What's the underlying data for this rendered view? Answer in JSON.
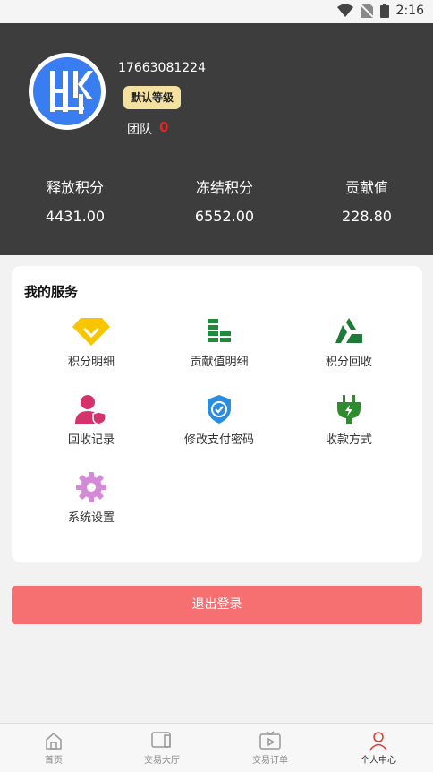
{
  "status_bar": {
    "time": "2:16"
  },
  "profile": {
    "phone": "17663081224",
    "level_badge": "默认等级",
    "team_label": "团队",
    "team_count": "0"
  },
  "stats": [
    {
      "label": "释放积分",
      "value": "4431.00"
    },
    {
      "label": "冻结积分",
      "value": "6552.00"
    },
    {
      "label": "贡献值",
      "value": "228.80"
    }
  ],
  "services": {
    "title": "我的服务",
    "items": [
      {
        "label": "积分明细",
        "icon": "diamond-icon"
      },
      {
        "label": "贡献值明细",
        "icon": "coin-stack-icon"
      },
      {
        "label": "积分回收",
        "icon": "recycle-icon"
      },
      {
        "label": "回收记录",
        "icon": "user-shield-icon"
      },
      {
        "label": "修改支付密码",
        "icon": "shield-check-icon"
      },
      {
        "label": "收款方式",
        "icon": "plug-icon"
      },
      {
        "label": "系统设置",
        "icon": "gear-icon"
      }
    ]
  },
  "logout_label": "退出登录",
  "tabs": [
    {
      "label": "首页",
      "icon": "home-icon"
    },
    {
      "label": "交易大厅",
      "icon": "tablet-icon"
    },
    {
      "label": "交易订单",
      "icon": "tv-play-icon"
    },
    {
      "label": "个人中心",
      "icon": "person-icon"
    }
  ],
  "colors": {
    "header_bg": "#3d3d3d",
    "accent_red": "#f66f71",
    "badge_bg": "#f5e19f",
    "team_count": "#e52424"
  }
}
